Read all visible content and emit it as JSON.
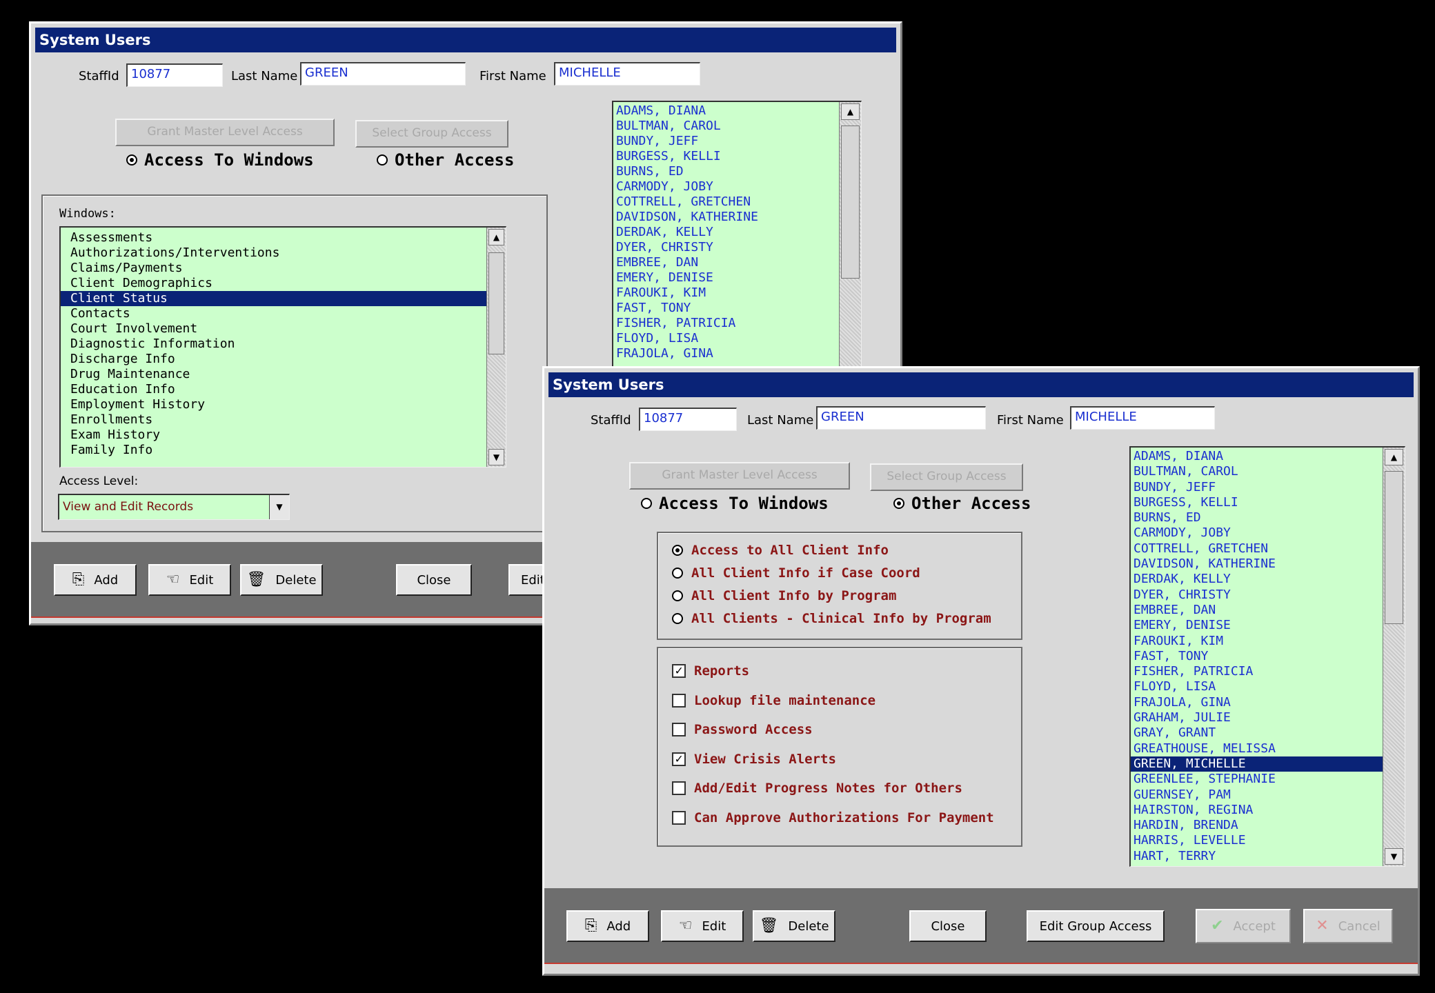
{
  "window1": {
    "title": "System Users",
    "staffid_label": "StaffId",
    "staffid_value": "10877",
    "lastname_label": "Last Name",
    "lastname_value": "GREEN",
    "firstname_label": "First Name",
    "firstname_value": "MICHELLE",
    "grant_master_label": "Grant Master Level Access",
    "select_group_label": "Select Group Access",
    "radio_windows_label": "Access To Windows",
    "radio_other_label": "Other Access",
    "selected_radio": "windows",
    "windows_label": "Windows:",
    "windows_items": [
      "Assessments",
      "Authorizations/Interventions",
      "Claims/Payments",
      "Client Demographics",
      "Client Status",
      "Contacts",
      "Court Involvement",
      "Diagnostic Information",
      "Discharge Info",
      "Drug Maintenance",
      "Education Info",
      "Employment History",
      "Enrollments",
      "Exam History",
      "Family Info"
    ],
    "windows_selected": "Client Status",
    "access_level_label": "Access Level:",
    "access_level_value": "View and Edit Records",
    "users": [
      "ADAMS, DIANA",
      "BULTMAN, CAROL",
      "BUNDY, JEFF",
      "BURGESS, KELLI",
      "BURNS, ED",
      "CARMODY, JOBY",
      "COTTRELL, GRETCHEN",
      "DAVIDSON, KATHERINE",
      "DERDAK, KELLY",
      "DYER, CHRISTY",
      "EMBREE, DAN",
      "EMERY, DENISE",
      "FAROUKI, KIM",
      "FAST, TONY",
      "FISHER, PATRICIA",
      "FLOYD, LISA",
      "FRAJOLA, GINA"
    ],
    "buttons": {
      "add": "Add",
      "edit": "Edit",
      "delete": "Delete",
      "close": "Close",
      "edit_group": "Edit"
    }
  },
  "window2": {
    "title": "System Users",
    "staffid_label": "StaffId",
    "staffid_value": "10877",
    "lastname_label": "Last Name",
    "lastname_value": "GREEN",
    "firstname_label": "First Name",
    "firstname_value": "MICHELLE",
    "grant_master_label": "Grant Master Level Access",
    "select_group_label": "Select Group Access",
    "radio_windows_label": "Access To Windows",
    "radio_other_label": "Other Access",
    "selected_radio": "other",
    "client_info_options": [
      "Access to All Client Info",
      "All Client Info if Case Coord",
      "All Client Info by Program",
      "All Clients - Clinical Info by Program"
    ],
    "client_info_selected": "Access to All Client Info",
    "checkboxes": [
      {
        "label": "Reports",
        "checked": true
      },
      {
        "label": "Lookup file maintenance",
        "checked": false
      },
      {
        "label": "Password Access",
        "checked": false
      },
      {
        "label": "View Crisis Alerts",
        "checked": true
      },
      {
        "label": "Add/Edit Progress Notes for Others",
        "checked": false
      },
      {
        "label": "Can Approve Authorizations For Payment",
        "checked": false
      }
    ],
    "users": [
      "ADAMS, DIANA",
      "BULTMAN, CAROL",
      "BUNDY, JEFF",
      "BURGESS, KELLI",
      "BURNS, ED",
      "CARMODY, JOBY",
      "COTTRELL, GRETCHEN",
      "DAVIDSON, KATHERINE",
      "DERDAK, KELLY",
      "DYER, CHRISTY",
      "EMBREE, DAN",
      "EMERY, DENISE",
      "FAROUKI, KIM",
      "FAST, TONY",
      "FISHER, PATRICIA",
      "FLOYD, LISA",
      "FRAJOLA, GINA",
      "GRAHAM, JULIE",
      "GRAY, GRANT",
      "GREATHOUSE, MELISSA",
      "GREEN, MICHELLE",
      "GREENLEE, STEPHANIE",
      "GUERNSEY, PAM",
      "HAIRSTON, REGINA",
      "HARDIN, BRENDA",
      "HARRIS, LEVELLE",
      "HART, TERRY"
    ],
    "users_selected": "GREEN, MICHELLE",
    "buttons": {
      "add": "Add",
      "edit": "Edit",
      "delete": "Delete",
      "close": "Close",
      "edit_group": "Edit Group Access",
      "accept": "Accept",
      "cancel": "Cancel"
    }
  },
  "icons": {
    "add": "add-record-icon",
    "edit": "pointing-hand-icon",
    "delete": "trash-can-icon",
    "accept": "checkmark-icon",
    "cancel": "x-mark-icon"
  },
  "colors": {
    "titlebar": "#0a2377",
    "list_bg": "#ccffcc",
    "list_text": "#1a2fd0",
    "selection": "#0a2377",
    "option_text": "#8b1616",
    "toolbar": "#6e6e6e"
  }
}
